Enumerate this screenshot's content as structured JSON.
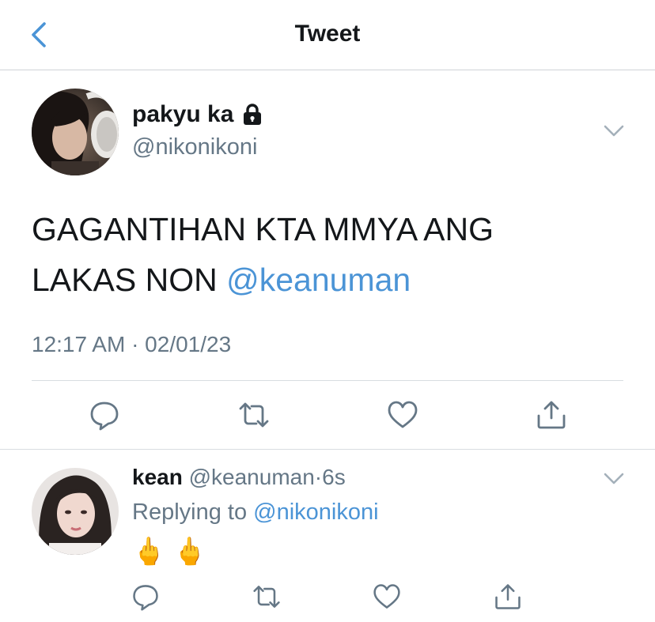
{
  "header": {
    "title": "Tweet",
    "back_icon": "chevron-left-icon",
    "accent": "#4b94d6"
  },
  "tweet": {
    "display_name": "pakyu ka",
    "locked_icon": "lock-icon",
    "handle": "@nikonikoni",
    "text": "GAGANTIHAN KTA MMYA ANG LAKAS NON",
    "mention": "@keanuman",
    "timestamp": "12:17 AM · 02/01/23",
    "actions": [
      "reply-icon",
      "retweet-icon",
      "like-icon",
      "share-icon"
    ]
  },
  "reply": {
    "display_name": "kean",
    "handle": "@keanuman",
    "separator": "·",
    "age": "6s",
    "replying_to_label": "Replying to",
    "replying_to_handle": "@nikonikoni",
    "body": "🖕 🖕",
    "actions": [
      "reply-icon",
      "retweet-icon",
      "like-icon",
      "share-icon"
    ]
  },
  "colors": {
    "text": "#14171a",
    "secondary": "#657786",
    "link": "#4b94d6",
    "divider": "#d8dde1"
  }
}
